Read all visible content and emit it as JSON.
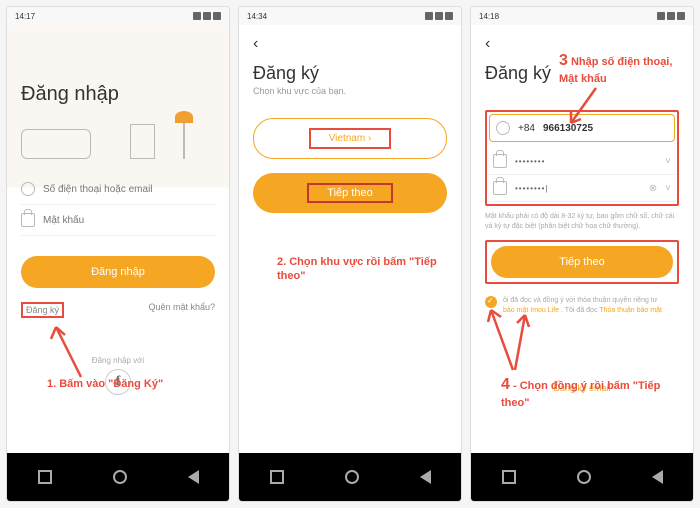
{
  "screen1": {
    "time": "14:17",
    "title": "Đăng nhập",
    "phone_placeholder": "Số điện thoại hoặc email",
    "pwd_placeholder": "Mật khẩu",
    "login_btn": "Đăng nhập",
    "register_link": "Đăng ký",
    "forgot_link": "Quên mật khẩu?",
    "footer_text": "Đăng nhập với",
    "fb_icon": "f",
    "annotation": "1. Bấm vào \"Đăng Ký\""
  },
  "screen2": {
    "time": "14:34",
    "title": "Đăng ký",
    "subtitle": "Chọn khu vực của bạn.",
    "region_btn": "Vietnam ›",
    "next_btn": "Tiếp theo",
    "annotation": "2. Chọn khu vực rồi bấm \"Tiếp theo\""
  },
  "screen3": {
    "time": "14:18",
    "title": "Đăng ký",
    "phone_prefix": "+84",
    "phone_value": "966130725",
    "pwd1": "••••••••",
    "pwd2": "••••••••|",
    "hint": "Mật khẩu phải có độ dài 8-32 ký tự, bao gồm chữ số, chữ cái và ký tự đặc biệt (phân biệt chữ hoa chữ thường).",
    "next_btn": "Tiếp theo",
    "checkbox_text": "ôi đã đọc và đồng ý với thỏa thuận quyền riêng tư",
    "privacy_link1": "bảo mật",
    "privacy_mid": "Imou Life",
    "privacy_text2": ". Tôi đã đọc",
    "privacy_link2": "Thỏa thuận bảo mật",
    "email_link": "Đăng ký email",
    "annotation3_num": "3",
    "annotation3": "Nhập số điện thoại, Mật khẩu",
    "annotation4_num": "4",
    "annotation4": "- Chọn đồng ý rồi bấm \"Tiếp theo\""
  }
}
